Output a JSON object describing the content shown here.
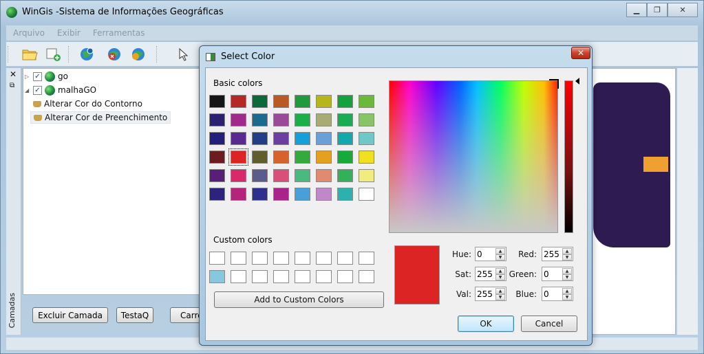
{
  "window": {
    "title": "WinGis -Sistema de Informações Geográficas"
  },
  "menu": [
    "Arquivo",
    "Exibir",
    "Ferramentas"
  ],
  "toolbar": {
    "icons": [
      "open-folder-icon",
      "new-layer-icon",
      "globe-info-icon",
      "globe-remove-icon",
      "globe-settings-icon",
      "pointer-icon"
    ]
  },
  "dock": {
    "label": "Camadas",
    "close": "✕",
    "float": "⧉"
  },
  "layers": [
    {
      "name": "go",
      "checked": true
    },
    {
      "name": "malhaGO",
      "checked": true
    }
  ],
  "layer_children": [
    "Alterar Cor do Contorno",
    "Alterar Cor de Preenchimento"
  ],
  "panel_buttons": {
    "delete": "Excluir Camada",
    "test": "TestaQ",
    "load": "Carre"
  },
  "dialog": {
    "title": "Select Color",
    "basic_colors_label": "Basic colors",
    "custom_colors_label": "Custom colors",
    "add_button": "Add to Custom Colors",
    "ok": "OK",
    "cancel": "Cancel",
    "fields": {
      "hue_label": "Hue:",
      "hue": "0",
      "sat_label": "Sat:",
      "sat": "255",
      "val_label": "Val:",
      "val": "255",
      "red_label": "Red:",
      "red": "255",
      "green_label": "Green:",
      "green": "0",
      "blue_label": "Blue:",
      "blue": "0"
    },
    "selected_color": "#dc2424",
    "basic_colors": [
      [
        "#151515",
        "#b52828",
        "#0b6a3a",
        "#b85a22",
        "#1f9a3c",
        "#b6b51c",
        "#14a23e",
        "#6bb83a"
      ],
      [
        "#2a2270",
        "#a02a8a",
        "#1e6a8c",
        "#9b4a98",
        "#1cae48",
        "#a9ab76",
        "#1aac54",
        "#8ac468"
      ],
      [
        "#24207a",
        "#5b2a90",
        "#233e86",
        "#6b3ea0",
        "#16a0d8",
        "#6aa0d8",
        "#13a8ac",
        "#6ec8c8"
      ],
      [
        "#6a1c1e",
        "#dc2424",
        "#5e5e2c",
        "#d8622c",
        "#34aa3e",
        "#e6a020",
        "#16aa3a",
        "#f0e020"
      ],
      [
        "#5a1e78",
        "#d82a6a",
        "#5c5c8a",
        "#d8507a",
        "#4ab880",
        "#e08a70",
        "#32b05a",
        "#f0ec80"
      ],
      [
        "#2c247c",
        "#b4247a",
        "#2e2e8e",
        "#a8248a",
        "#48a0d8",
        "#c088c8",
        "#2cb0b0",
        "#ffffff"
      ]
    ],
    "custom_colors": [
      [
        "#ffffff",
        "#ffffff",
        "#ffffff",
        "#ffffff",
        "#ffffff",
        "#ffffff",
        "#ffffff",
        "#ffffff"
      ],
      [
        "#88c8dc",
        "#ffffff",
        "#ffffff",
        "#ffffff",
        "#ffffff",
        "#ffffff",
        "#ffffff",
        "#ffffff"
      ]
    ]
  }
}
